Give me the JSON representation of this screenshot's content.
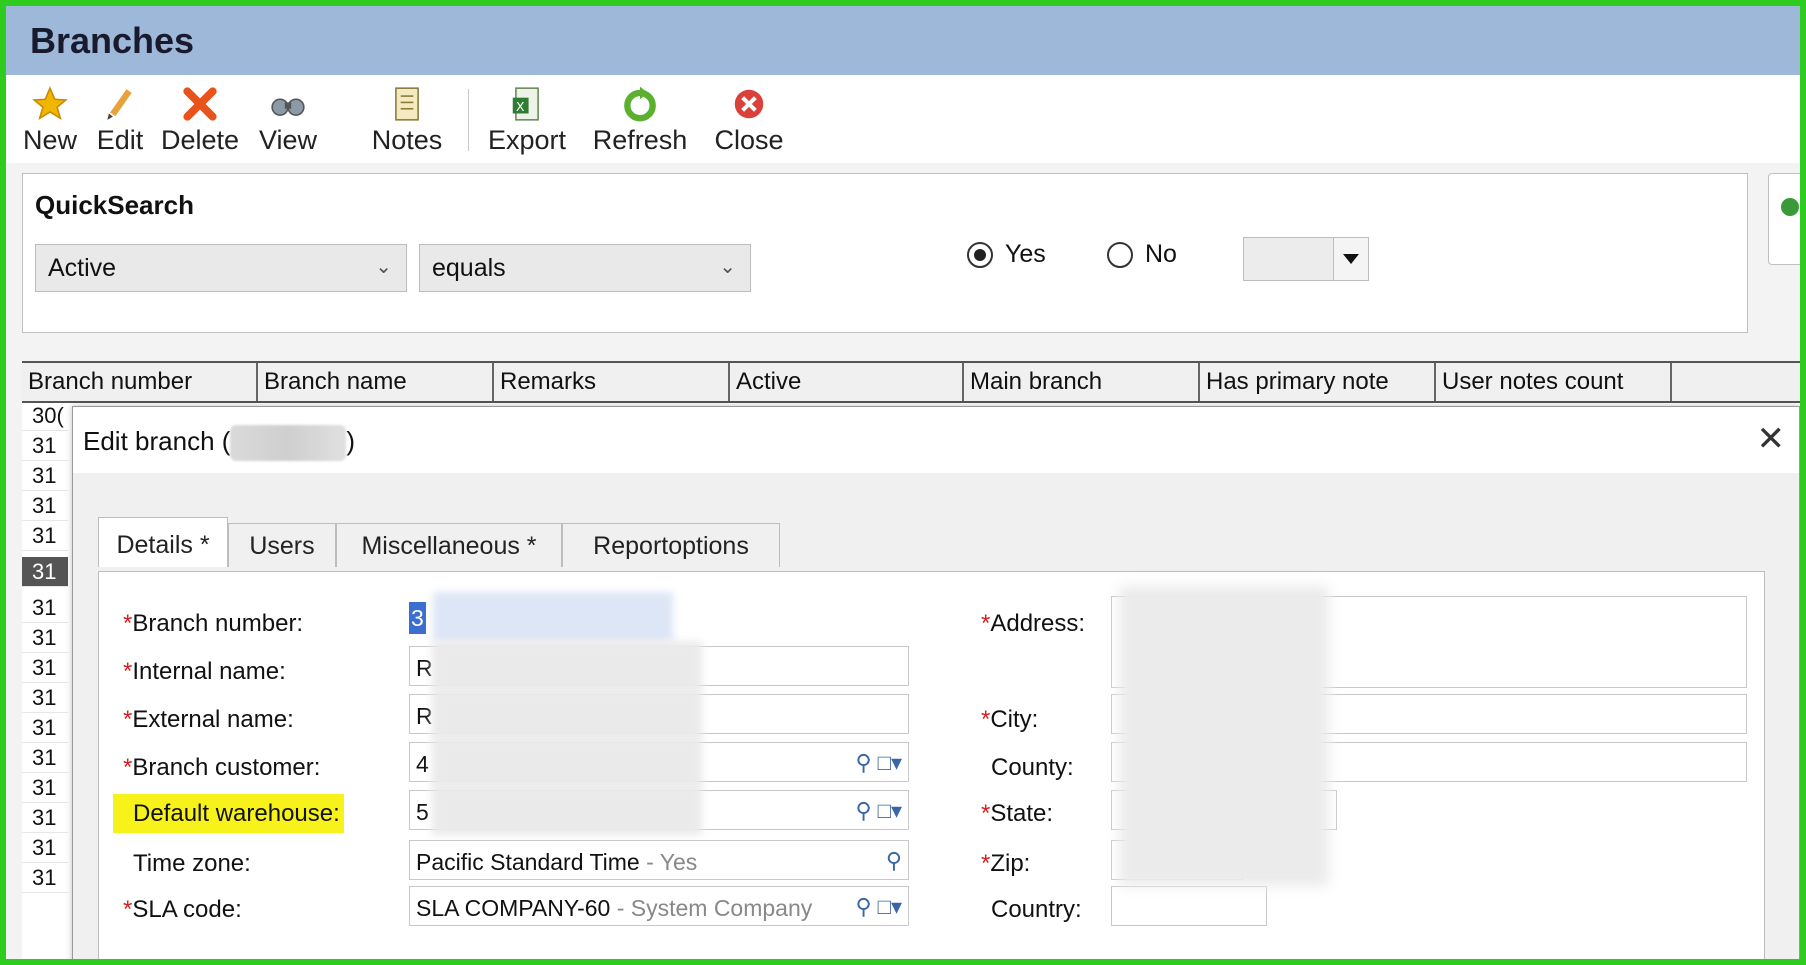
{
  "window": {
    "title": "Branches"
  },
  "toolbar": {
    "buttons": [
      {
        "label": "New",
        "icon": "star-icon"
      },
      {
        "label": "Edit",
        "icon": "pencil-icon"
      },
      {
        "label": "Delete",
        "icon": "delete-x-icon"
      },
      {
        "label": "View",
        "icon": "binoculars-icon"
      },
      {
        "label": "Notes",
        "icon": "notes-icon"
      },
      {
        "label": "Export",
        "icon": "excel-icon"
      },
      {
        "label": "Refresh",
        "icon": "refresh-icon"
      },
      {
        "label": "Close",
        "icon": "close-red-icon"
      }
    ]
  },
  "quicksearch": {
    "title": "QuickSearch",
    "field": "Active",
    "operator": "equals",
    "options": [
      {
        "label": "Yes",
        "selected": true
      },
      {
        "label": "No",
        "selected": false
      }
    ]
  },
  "grid": {
    "columns": [
      "Branch number",
      "Branch name",
      "Remarks",
      "Active",
      "Main branch",
      "Has primary note",
      "User notes count"
    ],
    "rows": [
      "30(",
      "31",
      "31",
      "31",
      "31",
      "31",
      "31",
      "31",
      "31",
      "31",
      "31",
      "31",
      "31",
      "31",
      "31",
      "31"
    ]
  },
  "dialog": {
    "title_prefix": "Edit branch (",
    "title_suffix": ")",
    "tabs": [
      {
        "label": "Details *",
        "active": true
      },
      {
        "label": "Users",
        "active": false
      },
      {
        "label": "Miscellaneous *",
        "active": false
      },
      {
        "label": "Reportoptions",
        "active": false
      }
    ],
    "left_fields": {
      "branch_number": {
        "label": "Branch number:",
        "required": true,
        "value": "3"
      },
      "internal_name": {
        "label": "Internal name:",
        "required": true,
        "value": "R"
      },
      "external_name": {
        "label": "External name:",
        "required": true,
        "value": "R"
      },
      "branch_customer": {
        "label": "Branch customer:",
        "required": true,
        "value": "4"
      },
      "default_warehouse": {
        "label": "Default warehouse:",
        "required": false,
        "value": "5"
      },
      "time_zone": {
        "label": "Time zone:",
        "required": false,
        "value": "Pacific Standard Time",
        "suffix": " - Yes"
      },
      "sla_code": {
        "label": "SLA code:",
        "required": true,
        "value": "SLA COMPANY-60",
        "suffix": " - System Company F"
      }
    },
    "right_fields": {
      "address": {
        "label": "Address:",
        "required": true
      },
      "city": {
        "label": "City:",
        "required": true
      },
      "county": {
        "label": "County:",
        "required": false
      },
      "state": {
        "label": "State:",
        "required": true
      },
      "zip": {
        "label": "Zip:",
        "required": true
      },
      "country": {
        "label": "Country:",
        "required": false
      }
    },
    "required_marker": "*"
  },
  "colors": {
    "titlebar": "#9db8d8",
    "highlight": "#f6f21a",
    "required": "#d42020",
    "selection": "#3b6ed0",
    "frame": "#2ecc1f"
  }
}
